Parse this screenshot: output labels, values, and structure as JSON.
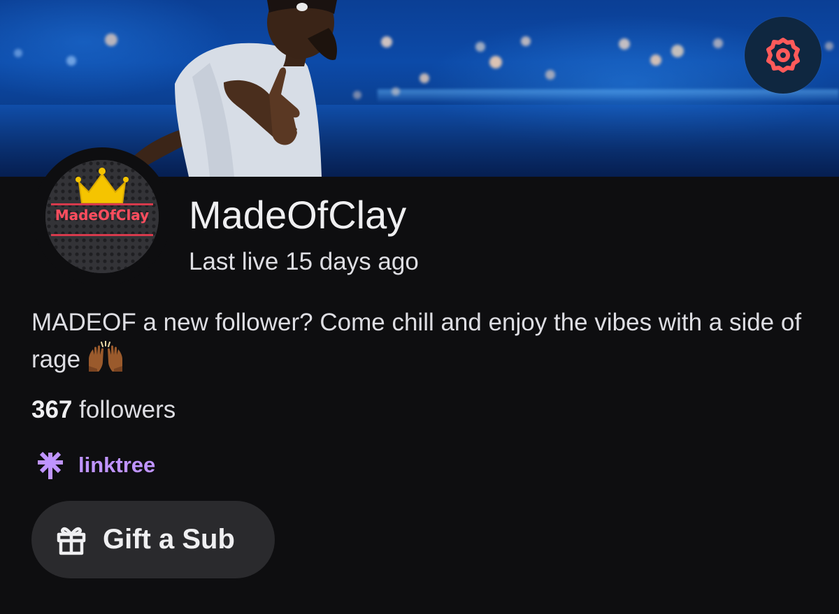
{
  "header": {
    "settings_icon": "gear-icon"
  },
  "channel": {
    "avatar_text": "MadeOfClay",
    "name": "MadeOfClay",
    "last_live": "Last live 15 days ago",
    "bio": "MADEOF a new follower? Come chill and enjoy the vibes with a side of rage",
    "bio_emoji": "raising-hands-emoji",
    "followers_count": "367",
    "followers_label": "followers"
  },
  "links": [
    {
      "icon": "linktree-icon",
      "label": "linktree"
    }
  ],
  "actions": {
    "gift_icon": "gift-icon",
    "gift_label": "Gift a Sub"
  },
  "colors": {
    "background": "#0e0e10",
    "accent_purple": "#bf94ff",
    "settings_icon": "#ff5a5a",
    "avatar_text": "#ff4d5e",
    "crown": "#f5c400",
    "button_bg": "#2a2a2d"
  }
}
